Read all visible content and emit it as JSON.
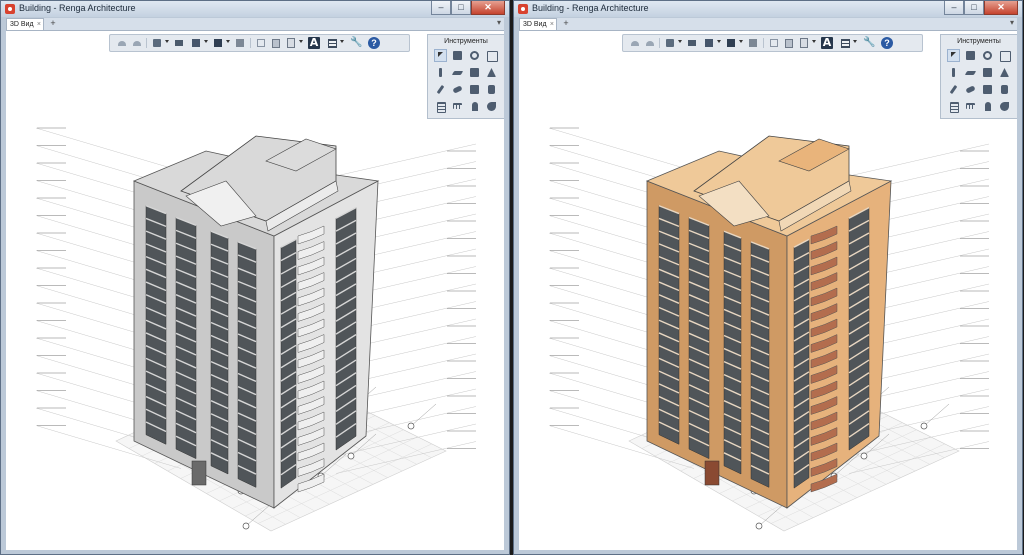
{
  "windows": [
    {
      "id": "left",
      "title": "Building - Renga Architecture",
      "tab_label": "3D Вид",
      "tab_close": "×",
      "tab_add": "+",
      "tab_menu": "▾",
      "tools_title": "Инструменты",
      "controls": {
        "minimize": "–",
        "maximize": "□",
        "close": "✕"
      },
      "render_mode": "monochrome",
      "colors": {
        "facade": "#e3e3e3",
        "facade_shadow": "#c9c9c9",
        "roof": "#d9d9d9",
        "balcony": "#efefef"
      }
    },
    {
      "id": "right",
      "title": "Building - Renga Architecture",
      "tab_label": "3D Вид",
      "tab_close": "×",
      "tab_add": "+",
      "tab_menu": "▾",
      "tools_title": "Инструменты",
      "controls": {
        "minimize": "–",
        "maximize": "□",
        "close": "✕"
      },
      "render_mode": "colored",
      "colors": {
        "facade": "#e6b27c",
        "facade_shadow": "#cf9a64",
        "roof": "#efc999",
        "balcony": "#b36d4e"
      }
    }
  ],
  "toolbar": {
    "text_button_label": "A",
    "help_label": "?",
    "wrench_label": "🔧",
    "icons": [
      "undo-icon",
      "redo-icon",
      "view-cube-icon",
      "open-folder-icon",
      "print-preview-icon",
      "export-icon",
      "printer-icon",
      "cut-icon",
      "copy-icon",
      "paste-icon",
      "text-icon",
      "table-icon",
      "settings-wrench-icon",
      "help-icon"
    ]
  },
  "tools": {
    "icons": [
      "select-arrow-icon",
      "rotate-icon",
      "wall-icon",
      "column-icon",
      "slab-icon",
      "beam-icon",
      "roof-icon",
      "pencil-icon",
      "ramp-icon",
      "window-icon",
      "door-icon",
      "staircase-icon",
      "railing-icon",
      "figure-icon",
      "opening-icon",
      "room-icon"
    ]
  }
}
